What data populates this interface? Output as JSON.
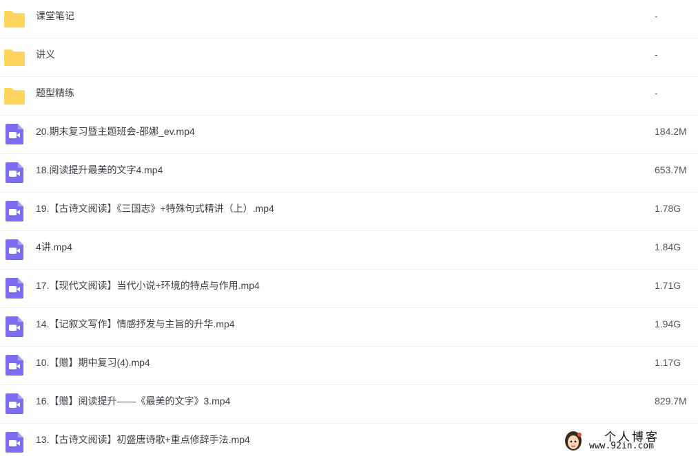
{
  "files": [
    {
      "type": "folder",
      "icon": "folder-icon",
      "name": "课堂笔记",
      "size": "-"
    },
    {
      "type": "folder",
      "icon": "folder-icon",
      "name": "讲义",
      "size": "-"
    },
    {
      "type": "folder",
      "icon": "folder-icon",
      "name": "题型精练",
      "size": "-"
    },
    {
      "type": "video",
      "icon": "video-file-icon",
      "name": "20.期末复习暨主题班会-邵娜_ev.mp4",
      "size": "184.2M"
    },
    {
      "type": "video",
      "icon": "video-file-icon",
      "name": "18.阅读提升最美的文字4.mp4",
      "size": "653.7M"
    },
    {
      "type": "video",
      "icon": "video-file-icon",
      "name": "19.【古诗文阅读】《三国志》+特殊句式精讲（上）.mp4",
      "size": "1.78G"
    },
    {
      "type": "video",
      "icon": "video-file-icon",
      "name": "4讲.mp4",
      "size": "1.84G"
    },
    {
      "type": "video",
      "icon": "video-file-icon",
      "name": "17.【现代文阅读】当代小说+环境的特点与作用.mp4",
      "size": "1.71G"
    },
    {
      "type": "video",
      "icon": "video-file-icon",
      "name": "14.【记叙文写作】情感抒发与主旨的升华.mp4",
      "size": "1.94G"
    },
    {
      "type": "video",
      "icon": "video-file-icon",
      "name": "10.【赠】期中复习(4).mp4",
      "size": "1.17G"
    },
    {
      "type": "video",
      "icon": "video-file-icon",
      "name": "16.【赠】阅读提升——《最美的文字》3.mp4",
      "size": "829.7M"
    },
    {
      "type": "video",
      "icon": "video-file-icon",
      "name": "13.【古诗文阅读】初盛唐诗歌+重点修辞手法.mp4",
      "size": ""
    }
  ],
  "watermark": {
    "title": "个人博客",
    "url": "www.92in.com"
  },
  "colors": {
    "folder": "#ffd45c",
    "video": "#7c6cf0",
    "text": "#3c3f45",
    "divider": "#f1f2f4"
  }
}
